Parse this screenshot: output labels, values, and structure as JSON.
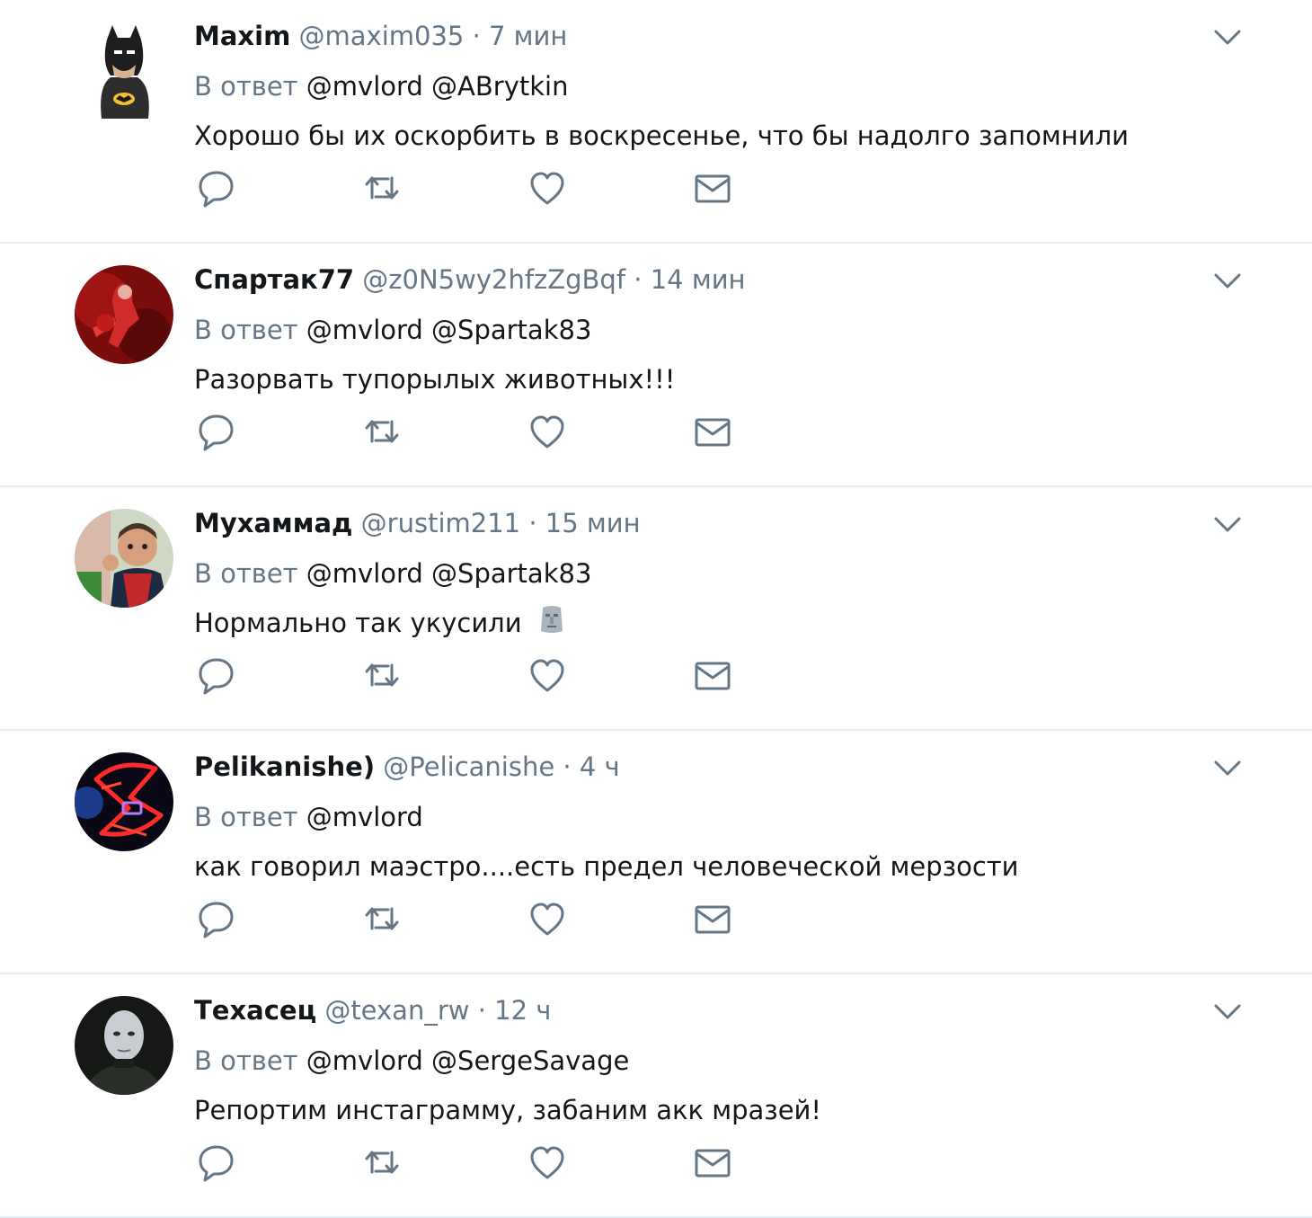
{
  "ui": {
    "reply_prefix": "В ответ",
    "separator": "·",
    "icons": {
      "reply": "reply-icon",
      "retweet": "retweet-icon",
      "like": "heart-icon",
      "dm": "envelope-icon",
      "more": "chevron-down-icon"
    },
    "colors": {
      "muted": "#657786",
      "text": "#14171a",
      "divider": "#e6ecf0"
    }
  },
  "tweets": [
    {
      "name": "Maxim",
      "handle": "@maxim035",
      "time": "7 мин",
      "mentions": "@mvlord @ABrytkin",
      "text": "Хорошо бы их оскорбить в воскресенье, что бы надолго запомнили"
    },
    {
      "name": "Спартак77",
      "handle": "@z0N5wy2hfzZgBqf",
      "time": "14 мин",
      "mentions": "@mvlord @Spartak83",
      "text": "Разорвать тупорылых животных!!!"
    },
    {
      "name": "Мухаммад",
      "handle": "@rustim211",
      "time": "15 мин",
      "mentions": "@mvlord @Spartak83",
      "text": "Нормально так укусили"
    },
    {
      "name": "Pelikanishe)",
      "handle": "@Pelicanishe",
      "time": "4 ч",
      "mentions": "@mvlord",
      "text": "как говорил маэстро....есть предел человеческой мерзости"
    },
    {
      "name": "Техасец",
      "handle": "@texan_rw",
      "time": "12 ч",
      "mentions": "@mvlord @SergeSavage",
      "text": "Репортим инстаграмму, забаним акк мразей!"
    }
  ]
}
